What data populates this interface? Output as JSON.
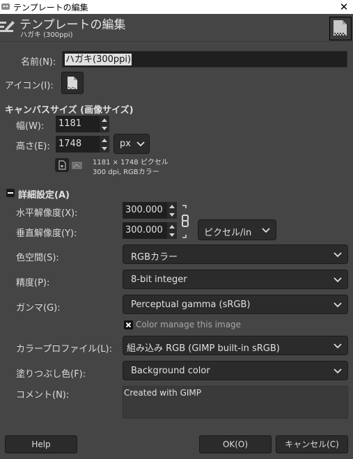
{
  "window": {
    "title": "テンプレートの編集",
    "close_icon": "close-icon"
  },
  "header": {
    "title": "テンプレートの編集",
    "subtitle": "ハガキ (300ppi)"
  },
  "form": {
    "name_label": "名前(N):",
    "name_value": "ハガキ(300ppi)",
    "icon_label": "アイコン(I):",
    "canvas_section_title": "キャンバスサイズ (画像サイズ)",
    "width_label": "幅(W):",
    "width_value": "1181",
    "height_label": "高さ(E):",
    "height_value": "1748",
    "unit_value": "px",
    "info_line1": "1181 × 1748 ピクセル",
    "info_line2": "300 dpi, RGBカラー",
    "advanced_title": "詳細設定(A)",
    "xres_label": "水平解像度(X):",
    "xres_value": "300.000",
    "yres_label": "垂直解像度(Y):",
    "yres_value": "300.000",
    "res_unit_value": "ピクセル/in",
    "colorspace_label": "色空間(S):",
    "colorspace_value": "RGBカラー",
    "precision_label": "精度(P):",
    "precision_value": "8-bit integer",
    "gamma_label": "ガンマ(G):",
    "gamma_value": "Perceptual gamma (sRGB)",
    "color_manage_label": "Color manage this image",
    "color_manage_checked": true,
    "profile_label": "カラープロファイル(L):",
    "profile_value": "組み込み RGB (GIMP built-in sRGB)",
    "fill_label": "塗りつぶし色(F):",
    "fill_value": "Background color",
    "comment_label": "コメント(N):",
    "comment_value": "Created with GIMP"
  },
  "buttons": {
    "help": "Help",
    "ok": "OK(O)",
    "cancel": "キャンセル(C)"
  }
}
